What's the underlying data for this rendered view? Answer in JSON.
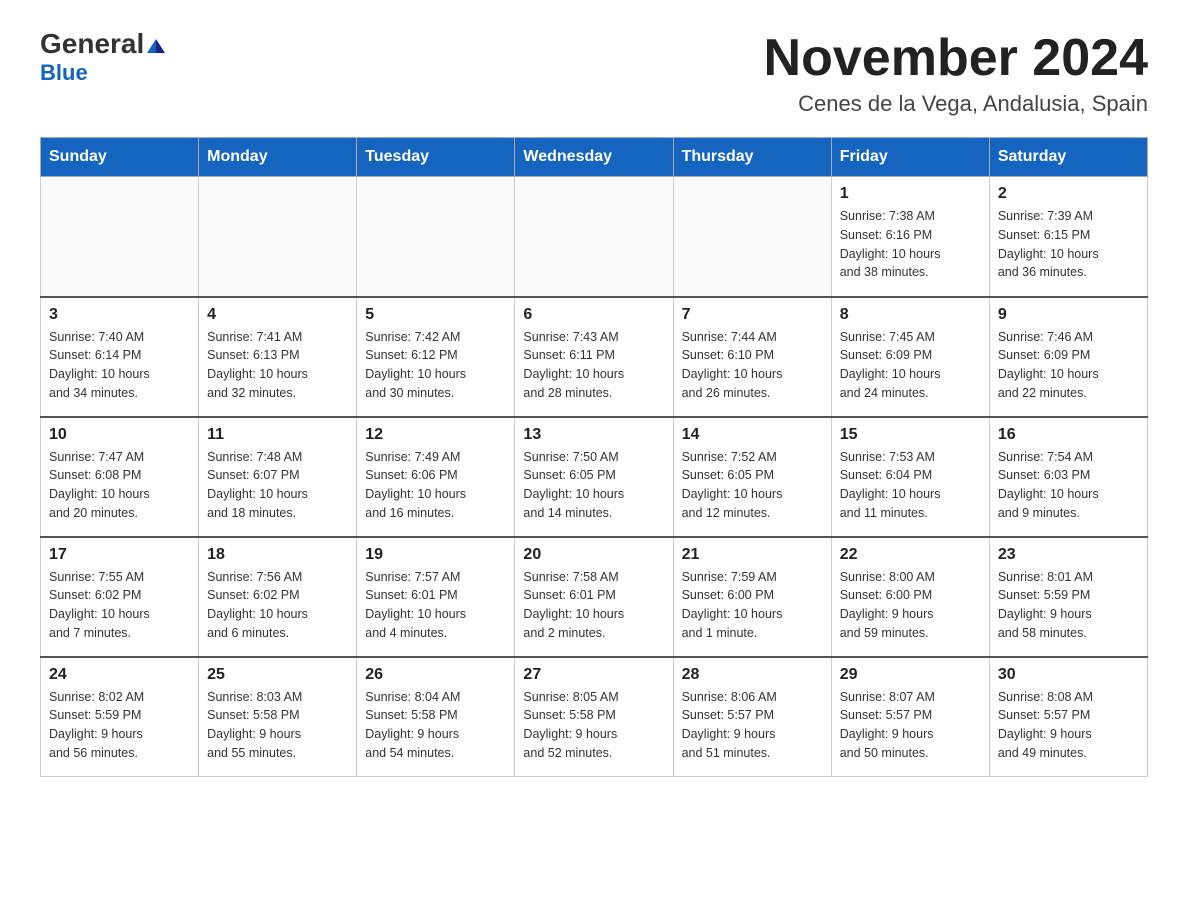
{
  "header": {
    "logo_line1": "General",
    "logo_line2": "Blue",
    "main_title": "November 2024",
    "subtitle": "Cenes de la Vega, Andalusia, Spain"
  },
  "weekdays": [
    "Sunday",
    "Monday",
    "Tuesday",
    "Wednesday",
    "Thursday",
    "Friday",
    "Saturday"
  ],
  "weeks": [
    [
      {
        "day": "",
        "info": ""
      },
      {
        "day": "",
        "info": ""
      },
      {
        "day": "",
        "info": ""
      },
      {
        "day": "",
        "info": ""
      },
      {
        "day": "",
        "info": ""
      },
      {
        "day": "1",
        "info": "Sunrise: 7:38 AM\nSunset: 6:16 PM\nDaylight: 10 hours\nand 38 minutes."
      },
      {
        "day": "2",
        "info": "Sunrise: 7:39 AM\nSunset: 6:15 PM\nDaylight: 10 hours\nand 36 minutes."
      }
    ],
    [
      {
        "day": "3",
        "info": "Sunrise: 7:40 AM\nSunset: 6:14 PM\nDaylight: 10 hours\nand 34 minutes."
      },
      {
        "day": "4",
        "info": "Sunrise: 7:41 AM\nSunset: 6:13 PM\nDaylight: 10 hours\nand 32 minutes."
      },
      {
        "day": "5",
        "info": "Sunrise: 7:42 AM\nSunset: 6:12 PM\nDaylight: 10 hours\nand 30 minutes."
      },
      {
        "day": "6",
        "info": "Sunrise: 7:43 AM\nSunset: 6:11 PM\nDaylight: 10 hours\nand 28 minutes."
      },
      {
        "day": "7",
        "info": "Sunrise: 7:44 AM\nSunset: 6:10 PM\nDaylight: 10 hours\nand 26 minutes."
      },
      {
        "day": "8",
        "info": "Sunrise: 7:45 AM\nSunset: 6:09 PM\nDaylight: 10 hours\nand 24 minutes."
      },
      {
        "day": "9",
        "info": "Sunrise: 7:46 AM\nSunset: 6:09 PM\nDaylight: 10 hours\nand 22 minutes."
      }
    ],
    [
      {
        "day": "10",
        "info": "Sunrise: 7:47 AM\nSunset: 6:08 PM\nDaylight: 10 hours\nand 20 minutes."
      },
      {
        "day": "11",
        "info": "Sunrise: 7:48 AM\nSunset: 6:07 PM\nDaylight: 10 hours\nand 18 minutes."
      },
      {
        "day": "12",
        "info": "Sunrise: 7:49 AM\nSunset: 6:06 PM\nDaylight: 10 hours\nand 16 minutes."
      },
      {
        "day": "13",
        "info": "Sunrise: 7:50 AM\nSunset: 6:05 PM\nDaylight: 10 hours\nand 14 minutes."
      },
      {
        "day": "14",
        "info": "Sunrise: 7:52 AM\nSunset: 6:05 PM\nDaylight: 10 hours\nand 12 minutes."
      },
      {
        "day": "15",
        "info": "Sunrise: 7:53 AM\nSunset: 6:04 PM\nDaylight: 10 hours\nand 11 minutes."
      },
      {
        "day": "16",
        "info": "Sunrise: 7:54 AM\nSunset: 6:03 PM\nDaylight: 10 hours\nand 9 minutes."
      }
    ],
    [
      {
        "day": "17",
        "info": "Sunrise: 7:55 AM\nSunset: 6:02 PM\nDaylight: 10 hours\nand 7 minutes."
      },
      {
        "day": "18",
        "info": "Sunrise: 7:56 AM\nSunset: 6:02 PM\nDaylight: 10 hours\nand 6 minutes."
      },
      {
        "day": "19",
        "info": "Sunrise: 7:57 AM\nSunset: 6:01 PM\nDaylight: 10 hours\nand 4 minutes."
      },
      {
        "day": "20",
        "info": "Sunrise: 7:58 AM\nSunset: 6:01 PM\nDaylight: 10 hours\nand 2 minutes."
      },
      {
        "day": "21",
        "info": "Sunrise: 7:59 AM\nSunset: 6:00 PM\nDaylight: 10 hours\nand 1 minute."
      },
      {
        "day": "22",
        "info": "Sunrise: 8:00 AM\nSunset: 6:00 PM\nDaylight: 9 hours\nand 59 minutes."
      },
      {
        "day": "23",
        "info": "Sunrise: 8:01 AM\nSunset: 5:59 PM\nDaylight: 9 hours\nand 58 minutes."
      }
    ],
    [
      {
        "day": "24",
        "info": "Sunrise: 8:02 AM\nSunset: 5:59 PM\nDaylight: 9 hours\nand 56 minutes."
      },
      {
        "day": "25",
        "info": "Sunrise: 8:03 AM\nSunset: 5:58 PM\nDaylight: 9 hours\nand 55 minutes."
      },
      {
        "day": "26",
        "info": "Sunrise: 8:04 AM\nSunset: 5:58 PM\nDaylight: 9 hours\nand 54 minutes."
      },
      {
        "day": "27",
        "info": "Sunrise: 8:05 AM\nSunset: 5:58 PM\nDaylight: 9 hours\nand 52 minutes."
      },
      {
        "day": "28",
        "info": "Sunrise: 8:06 AM\nSunset: 5:57 PM\nDaylight: 9 hours\nand 51 minutes."
      },
      {
        "day": "29",
        "info": "Sunrise: 8:07 AM\nSunset: 5:57 PM\nDaylight: 9 hours\nand 50 minutes."
      },
      {
        "day": "30",
        "info": "Sunrise: 8:08 AM\nSunset: 5:57 PM\nDaylight: 9 hours\nand 49 minutes."
      }
    ]
  ]
}
